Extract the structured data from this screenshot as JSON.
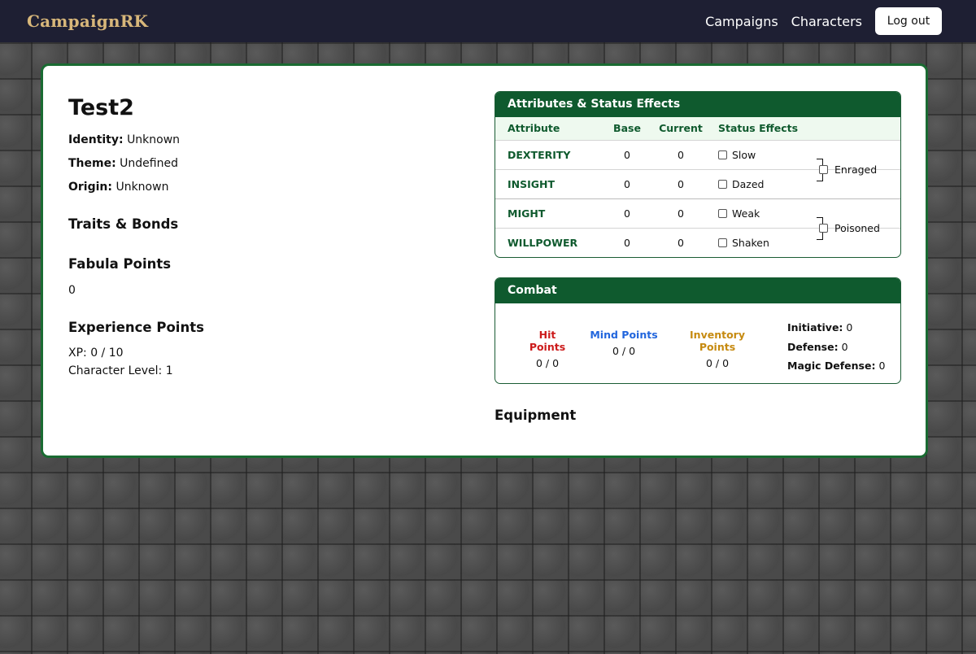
{
  "nav": {
    "brand": "CampaignRK",
    "links": [
      "Campaigns",
      "Characters"
    ],
    "logout_label": "Log out"
  },
  "character": {
    "name": "Test2",
    "identity_label": "Identity:",
    "identity": "Unknown",
    "theme_label": "Theme:",
    "theme": "Undefined",
    "origin_label": "Origin:",
    "origin": "Unknown",
    "traits_heading": "Traits & Bonds",
    "fabula_heading": "Fabula Points",
    "fabula_value": "0",
    "xp_heading": "Experience Points",
    "xp_line": "XP: 0 / 10",
    "level_line": "Character Level: 1"
  },
  "attributes": {
    "title": "Attributes & Status Effects",
    "headers": [
      "Attribute",
      "Base",
      "Current",
      "Status Effects"
    ],
    "rows": [
      {
        "name": "DEXTERITY",
        "base": "0",
        "current": "0",
        "status": "Slow"
      },
      {
        "name": "INSIGHT",
        "base": "0",
        "current": "0",
        "status": "Dazed"
      },
      {
        "name": "MIGHT",
        "base": "0",
        "current": "0",
        "status": "Weak"
      },
      {
        "name": "WILLPOWER",
        "base": "0",
        "current": "0",
        "status": "Shaken"
      }
    ],
    "combined": [
      "Enraged",
      "Poisoned"
    ]
  },
  "combat": {
    "title": "Combat",
    "hp_label": "Hit Points",
    "hp_value": "0 / 0",
    "mp_label": "Mind Points",
    "mp_value": "0 / 0",
    "ip_label": "Inventory Points",
    "ip_value": "0 / 0",
    "initiative_label": "Initiative:",
    "initiative": "0",
    "defense_label": "Defense:",
    "defense": "0",
    "magic_defense_label": "Magic Defense:",
    "magic_defense": "0"
  },
  "equipment_heading": "Equipment",
  "colors": {
    "nav_bg": "#1e1f33",
    "brand": "#d8b77a",
    "accent_green": "#0f5a2e",
    "hp": "#cc1b1b",
    "mp": "#2266dd",
    "ip": "#c68a10"
  }
}
